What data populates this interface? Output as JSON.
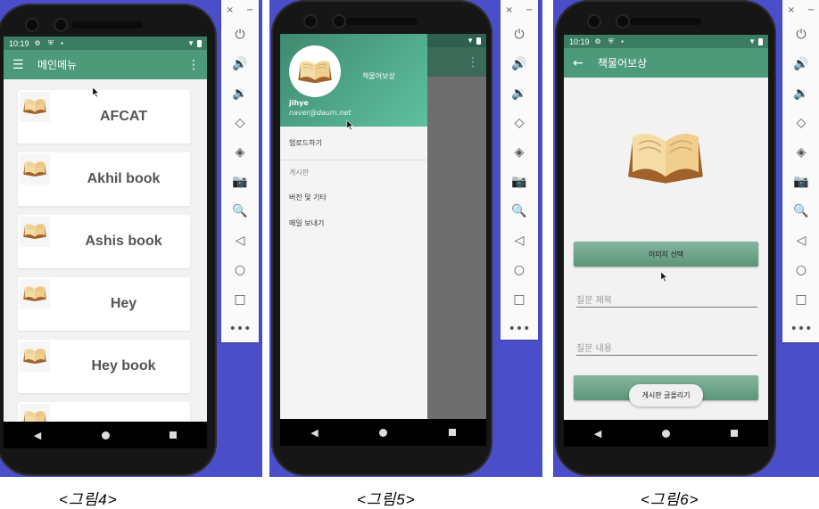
{
  "status": {
    "time": "10:19",
    "indicators": "⚙ ⛨ ▪",
    "wifi": "▼"
  },
  "fig4": {
    "menu_icon": "☰",
    "title": "메인메뉴",
    "more_icon": "⋮",
    "cards": [
      {
        "title": "AFCAT"
      },
      {
        "title": "Akhil book"
      },
      {
        "title": "Ashis book"
      },
      {
        "title": "Hey"
      },
      {
        "title": "Hey book"
      },
      {
        "title": ""
      }
    ],
    "caption": "<그림4>"
  },
  "fig5": {
    "drawer_title": "책물어보상",
    "user_name": "jihye",
    "user_email": "naver@daum.net",
    "items": {
      "upload": "업로드하기",
      "section": "게시판",
      "version": "버전 및 기타",
      "mail": "메일 보내기"
    },
    "caption": "<그림5>"
  },
  "fig6": {
    "back_icon": "←",
    "title": "책물어보상",
    "select_image_label": "이미지 선택",
    "title_placeholder": "질문 제목",
    "content_placeholder": "질문 내용",
    "toast": "게시판 글올리기",
    "caption": "<그림6>"
  },
  "emulator": {
    "close_icon": "×",
    "minimize_icon": "−",
    "buttons": [
      "⏻",
      "🔊",
      "🔉",
      "◇",
      "◈",
      "📷",
      "🔍",
      "◁",
      "○",
      "□",
      "•••"
    ]
  },
  "nav": {
    "back": "◀"
  },
  "colors": {
    "background": "#4a4fc9",
    "statusbar": "#3b7d63",
    "appbar": "#4c9a7a",
    "drawer_header": "#5ec1a0"
  }
}
